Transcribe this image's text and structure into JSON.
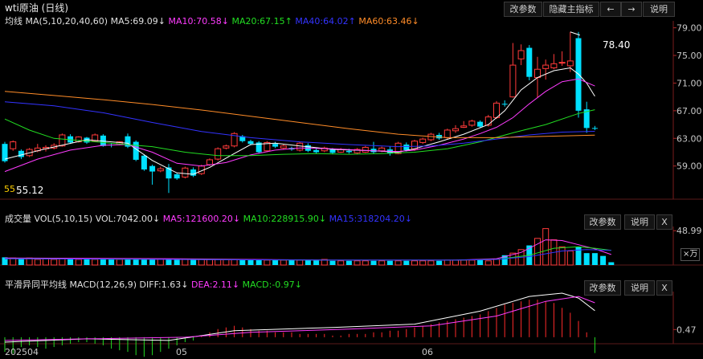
{
  "title": "wti原油 (日线)",
  "toolbar": {
    "params": "改参数",
    "hide": "隐藏主指标",
    "prev": "←",
    "next": "→",
    "help": "说明"
  },
  "colors": {
    "up": "#ff3a3a",
    "down": "#00e0ff",
    "ma5": "#ffffff",
    "ma10": "#ff3cff",
    "ma20": "#22dd22",
    "ma40": "#3333ff",
    "ma60": "#ff8c28"
  },
  "main": {
    "indicator_label": "均线",
    "params": "MA(5,10,20,40,60)",
    "legend": [
      {
        "text": "MA5:69.09↓",
        "color": "#e0e0e0"
      },
      {
        "text": "MA10:70.58↓",
        "color": "#ff3cff"
      },
      {
        "text": "MA20:67.15↑",
        "color": "#22dd22"
      },
      {
        "text": "MA40:64.02↑",
        "color": "#3333ff"
      },
      {
        "text": "MA60:63.46↓",
        "color": "#ff8c28"
      }
    ],
    "high_label": "78.40",
    "low_label": "55.12",
    "low_marker": "55"
  },
  "volume": {
    "indicator_label": "成交量",
    "params": "VOL(5,10,15)",
    "legend": [
      {
        "text": "VOL:7042.00↓",
        "color": "#e0e0e0"
      },
      {
        "text": "MA5:121600.20↓",
        "color": "#ff3cff"
      },
      {
        "text": "MA10:228915.90↓",
        "color": "#22dd22"
      },
      {
        "text": "MA15:318204.20↓",
        "color": "#3333ff"
      }
    ],
    "unit": "×万",
    "buttons": {
      "params": "改参数",
      "help": "说明",
      "close": "X"
    }
  },
  "macd": {
    "indicator_label": "平滑异同平均线",
    "params": "MACD(12,26,9)",
    "legend": [
      {
        "text": "DIFF:1.63↓",
        "color": "#e0e0e0"
      },
      {
        "text": "DEA:2.11↓",
        "color": "#ff3cff"
      },
      {
        "text": "MACD:-0.97↓",
        "color": "#22dd22"
      }
    ],
    "buttons": {
      "params": "改参数",
      "help": "说明",
      "close": "X"
    }
  },
  "x_labels": [
    "202504",
    "05",
    "06"
  ],
  "chart_data": [
    {
      "type": "candlestick",
      "title": "wti原油 (日线)",
      "yticks": [
        79.0,
        75.0,
        71.0,
        67.0,
        63.0,
        59.0
      ],
      "ylim": [
        54.2,
        80.0
      ],
      "candles": [
        [
          62.2,
          59.7,
          62.5,
          59.5
        ],
        [
          61.5,
          62.5,
          62.7,
          61.2
        ],
        [
          61.2,
          60.3,
          61.4,
          60.0
        ],
        [
          60.5,
          61.4,
          61.6,
          60.3
        ],
        [
          61.2,
          61.6,
          62.2,
          61.0
        ],
        [
          61.5,
          61.7,
          62.0,
          61.1
        ],
        [
          61.6,
          62.0,
          62.3,
          61.4
        ],
        [
          61.9,
          63.5,
          63.7,
          61.8
        ],
        [
          63.3,
          62.4,
          63.6,
          62.2
        ],
        [
          62.5,
          63.2,
          63.3,
          62.4
        ],
        [
          63.1,
          62.4,
          63.2,
          62.2
        ],
        [
          62.6,
          63.5,
          63.7,
          62.5
        ],
        [
          63.4,
          61.9,
          63.6,
          61.8
        ],
        [
          62.1,
          62.0,
          62.3,
          61.7
        ],
        [
          62.2,
          62.5,
          62.6,
          62.0
        ],
        [
          63.3,
          61.8,
          63.7,
          61.6
        ],
        [
          62.5,
          59.9,
          62.7,
          59.7
        ],
        [
          60.5,
          58.5,
          60.7,
          58.3
        ],
        [
          59.0,
          58.2,
          59.2,
          56.3
        ],
        [
          58.3,
          58.6,
          58.9,
          58.1
        ],
        [
          58.8,
          57.2,
          59.3,
          55.1
        ],
        [
          57.8,
          57.2,
          58.0,
          57.0
        ],
        [
          57.4,
          58.7,
          58.9,
          57.2
        ],
        [
          58.5,
          57.6,
          58.8,
          57.4
        ],
        [
          57.9,
          59.0,
          59.2,
          57.7
        ],
        [
          59.2,
          59.9,
          60.1,
          59.0
        ],
        [
          60.0,
          61.5,
          61.7,
          59.8
        ],
        [
          61.6,
          61.9,
          62.1,
          61.4
        ],
        [
          61.9,
          63.7,
          63.9,
          61.7
        ],
        [
          63.3,
          62.6,
          63.5,
          62.4
        ],
        [
          62.6,
          62.2,
          62.8,
          62.0
        ],
        [
          62.4,
          61.0,
          62.6,
          60.8
        ],
        [
          61.2,
          62.4,
          62.6,
          61.0
        ],
        [
          62.2,
          61.8,
          62.5,
          61.6
        ],
        [
          61.6,
          61.9,
          62.1,
          61.4
        ],
        [
          61.6,
          61.4,
          61.8,
          61.2
        ],
        [
          61.3,
          62.3,
          62.5,
          61.1
        ],
        [
          62.0,
          61.2,
          62.3,
          61.0
        ],
        [
          61.3,
          61.0,
          61.6,
          60.8
        ],
        [
          61.2,
          61.6,
          61.8,
          61.0
        ],
        [
          61.4,
          60.9,
          61.6,
          60.7
        ],
        [
          61.0,
          61.4,
          61.6,
          60.9
        ],
        [
          61.2,
          61.0,
          61.5,
          60.8
        ],
        [
          60.9,
          61.4,
          61.6,
          60.7
        ],
        [
          61.0,
          61.7,
          61.9,
          60.9
        ],
        [
          61.5,
          61.0,
          62.5,
          60.8
        ],
        [
          61.2,
          61.6,
          61.8,
          61.0
        ],
        [
          61.4,
          60.8,
          61.8,
          60.5
        ],
        [
          60.8,
          62.3,
          62.5,
          60.7
        ],
        [
          62.1,
          61.3,
          62.4,
          61.1
        ],
        [
          61.4,
          62.6,
          62.8,
          61.2
        ],
        [
          62.4,
          62.9,
          63.1,
          62.2
        ],
        [
          62.8,
          63.6,
          63.8,
          62.6
        ],
        [
          63.5,
          63.0,
          63.8,
          62.8
        ],
        [
          63.1,
          64.2,
          64.4,
          62.9
        ],
        [
          64.1,
          64.4,
          64.9,
          63.8
        ],
        [
          64.6,
          64.8,
          65.5,
          64.5
        ],
        [
          64.9,
          65.5,
          65.7,
          64.7
        ],
        [
          65.4,
          64.7,
          65.6,
          64.5
        ],
        [
          64.9,
          66.1,
          66.4,
          64.7
        ],
        [
          66.0,
          68.1,
          68.4,
          65.8
        ],
        [
          68.0,
          67.9,
          68.5,
          67.6
        ],
        [
          69.0,
          73.6,
          76.8,
          68.9
        ],
        [
          74.5,
          75.7,
          76.6,
          73.6
        ],
        [
          76.1,
          71.9,
          76.5,
          71.4
        ],
        [
          71.8,
          73.0,
          74.8,
          68.9
        ],
        [
          73.1,
          73.6,
          74.4,
          71.5
        ],
        [
          73.2,
          73.8,
          75.2,
          73.0
        ],
        [
          73.9,
          74.0,
          75.6,
          73.5
        ],
        [
          73.5,
          74.2,
          78.4,
          72.6
        ],
        [
          77.5,
          67.0,
          78.4,
          66.0
        ],
        [
          67.2,
          64.5,
          68.3,
          63.8
        ],
        [
          64.5,
          64.4,
          64.8,
          64.2
        ]
      ],
      "ma": {
        "ma5": [
          [
            0,
            60.0
          ],
          [
            5,
            61.5
          ],
          [
            10,
            62.8
          ],
          [
            13,
            62.5
          ],
          [
            15,
            62.3
          ],
          [
            18,
            59.8
          ],
          [
            21,
            58.0
          ],
          [
            23,
            57.8
          ],
          [
            25,
            58.8
          ],
          [
            28,
            60.8
          ],
          [
            30,
            62.1
          ],
          [
            33,
            62.3
          ],
          [
            36,
            61.9
          ],
          [
            40,
            61.4
          ],
          [
            45,
            61.2
          ],
          [
            48,
            61.0
          ],
          [
            50,
            61.5
          ],
          [
            53,
            62.5
          ],
          [
            56,
            63.6
          ],
          [
            59,
            65.0
          ],
          [
            61,
            67.0
          ],
          [
            63,
            70.0
          ],
          [
            65,
            71.8
          ],
          [
            67,
            72.8
          ],
          [
            69,
            73.2
          ],
          [
            70,
            72.3
          ],
          [
            71,
            71.0
          ],
          [
            72,
            69.09
          ]
        ],
        "ma10": [
          [
            0,
            58.2
          ],
          [
            4,
            60.0
          ],
          [
            8,
            61.3
          ],
          [
            12,
            62.0
          ],
          [
            15,
            62.1
          ],
          [
            18,
            61.0
          ],
          [
            21,
            59.4
          ],
          [
            24,
            59.0
          ],
          [
            27,
            59.5
          ],
          [
            30,
            60.6
          ],
          [
            33,
            61.3
          ],
          [
            36,
            61.6
          ],
          [
            40,
            61.5
          ],
          [
            45,
            61.2
          ],
          [
            48,
            61.1
          ],
          [
            50,
            61.3
          ],
          [
            53,
            62.0
          ],
          [
            56,
            62.9
          ],
          [
            58,
            63.7
          ],
          [
            60,
            64.6
          ],
          [
            62,
            66.0
          ],
          [
            64,
            68.0
          ],
          [
            66,
            69.8
          ],
          [
            68,
            71.2
          ],
          [
            70,
            71.6
          ],
          [
            72,
            70.58
          ]
        ],
        "ma20": [
          [
            0,
            65.8
          ],
          [
            3,
            64.2
          ],
          [
            6,
            63.0
          ],
          [
            10,
            62.6
          ],
          [
            14,
            62.2
          ],
          [
            18,
            61.8
          ],
          [
            22,
            61.0
          ],
          [
            26,
            60.5
          ],
          [
            30,
            60.5
          ],
          [
            34,
            60.7
          ],
          [
            38,
            60.8
          ],
          [
            42,
            60.7
          ],
          [
            46,
            60.8
          ],
          [
            50,
            61.0
          ],
          [
            54,
            61.5
          ],
          [
            58,
            62.5
          ],
          [
            62,
            63.8
          ],
          [
            66,
            65.0
          ],
          [
            70,
            66.6
          ],
          [
            72,
            67.15
          ]
        ],
        "ma40": [
          [
            0,
            68.3
          ],
          [
            6,
            67.7
          ],
          [
            12,
            66.7
          ],
          [
            18,
            65.3
          ],
          [
            24,
            64.0
          ],
          [
            30,
            63.1
          ],
          [
            36,
            62.5
          ],
          [
            42,
            62.1
          ],
          [
            48,
            61.8
          ],
          [
            52,
            61.9
          ],
          [
            56,
            62.3
          ],
          [
            60,
            62.9
          ],
          [
            64,
            63.5
          ],
          [
            68,
            63.9
          ],
          [
            72,
            64.02
          ]
        ],
        "ma60": [
          [
            0,
            69.8
          ],
          [
            6,
            69.2
          ],
          [
            12,
            68.6
          ],
          [
            18,
            67.9
          ],
          [
            24,
            67.1
          ],
          [
            30,
            66.2
          ],
          [
            36,
            65.3
          ],
          [
            42,
            64.4
          ],
          [
            48,
            63.6
          ],
          [
            54,
            63.1
          ],
          [
            60,
            63.1
          ],
          [
            66,
            63.3
          ],
          [
            72,
            63.46
          ]
        ]
      }
    },
    {
      "type": "bar",
      "title": "VOL(5,10,15)",
      "yticks": [
        48.99
      ],
      "ylim": [
        0,
        55
      ],
      "values": [
        11,
        10,
        9,
        10,
        8,
        9,
        8,
        9,
        9,
        8,
        9,
        8,
        9,
        8,
        8,
        8,
        9,
        8,
        8,
        8,
        9,
        8,
        8,
        8,
        8,
        8,
        8,
        8,
        8,
        8,
        8,
        8,
        7,
        8,
        7,
        7,
        7,
        7,
        7,
        8,
        6,
        6,
        6,
        6,
        6,
        6,
        6,
        6,
        6,
        6,
        6,
        6,
        6,
        6,
        7,
        7,
        7,
        7,
        7,
        6,
        8,
        14,
        17,
        22,
        28,
        38,
        52,
        36,
        26,
        20,
        26,
        17,
        17,
        13,
        4
      ]
    },
    {
      "type": "bar",
      "title": "MACD(12,26,9)",
      "yticks": [
        0.47
      ],
      "ylim": [
        -0.4,
        2.8
      ],
      "values": [
        -0.9,
        -1.0,
        -0.6,
        -0.5,
        -0.6,
        -0.7,
        -0.6,
        -0.5,
        -0.4,
        -0.3,
        -0.3,
        -0.4,
        -0.5,
        -0.7,
        -0.8,
        -0.9,
        -1.1,
        -1.2,
        -1.1,
        -0.9,
        -0.7,
        -0.5,
        -0.3,
        -0.2,
        0.1,
        0.3,
        0.5,
        0.6,
        0.7,
        0.6,
        0.5,
        0.4,
        0.4,
        0.3,
        0.3,
        0.3,
        0.2,
        0.2,
        0.2,
        0.2,
        0.1,
        0.1,
        0.2,
        0.2,
        0.2,
        0.3,
        0.3,
        0.4,
        0.4,
        0.5,
        0.6,
        0.7,
        0.8,
        0.9,
        1.0,
        1.1,
        1.2,
        1.3,
        1.4,
        1.6,
        1.8,
        2.0,
        2.1,
        2.2,
        2.3,
        2.3,
        2.2,
        2.1,
        1.8,
        1.5,
        1.0,
        0.3,
        -0.97
      ],
      "series": [
        {
          "name": "DIFF",
          "values": [
            [
              0,
              -0.3
            ],
            [
              10,
              -0.1
            ],
            [
              20,
              -0.2
            ],
            [
              28,
              0.4
            ],
            [
              40,
              0.6
            ],
            [
              50,
              0.8
            ],
            [
              58,
              1.6
            ],
            [
              64,
              2.5
            ],
            [
              68,
              2.7
            ],
            [
              70,
              2.4
            ],
            [
              72,
              1.63
            ]
          ]
        },
        {
          "name": "DEA",
          "values": [
            [
              0,
              -0.2
            ],
            [
              10,
              -0.1
            ],
            [
              22,
              0.0
            ],
            [
              30,
              0.3
            ],
            [
              42,
              0.5
            ],
            [
              52,
              0.7
            ],
            [
              60,
              1.3
            ],
            [
              66,
              2.2
            ],
            [
              70,
              2.5
            ],
            [
              72,
              2.11
            ]
          ]
        }
      ]
    }
  ]
}
